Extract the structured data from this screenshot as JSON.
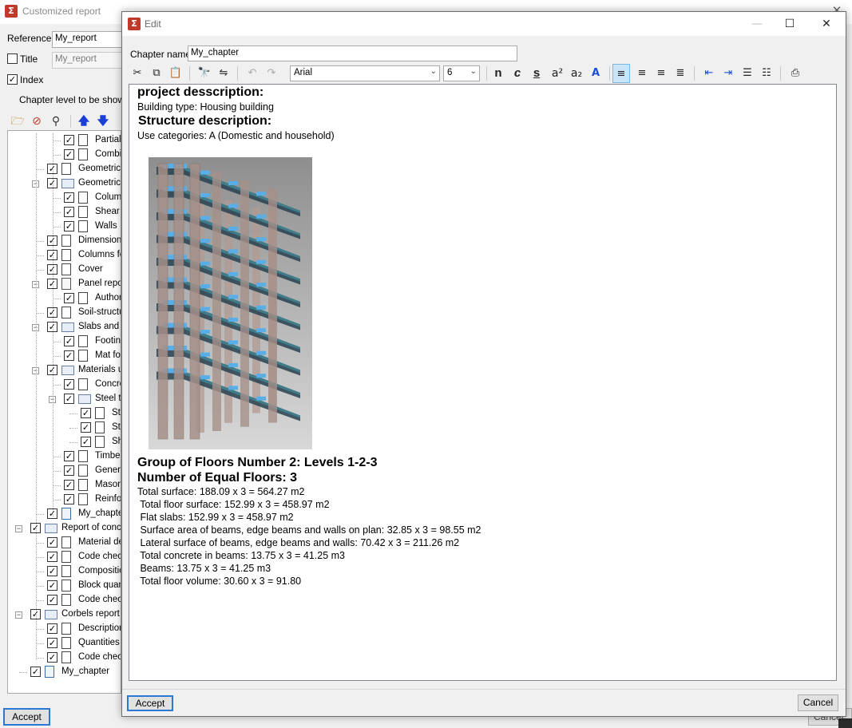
{
  "bg": {
    "title": "Customized report",
    "reference_label": "Reference",
    "reference_value": "My_report",
    "title_label": "Title",
    "title_value": "My_report",
    "index_label": "Index",
    "chapter_level_label": "Chapter level to be shown i",
    "accept_label": "Accept",
    "cancel_peek": "Cancel"
  },
  "tree": [
    {
      "label": "Partial s",
      "level": 3,
      "checked": true,
      "icon": "doc"
    },
    {
      "label": "Combin",
      "level": 3,
      "checked": true,
      "icon": "doc"
    },
    {
      "label": "Geometrical",
      "level": 2,
      "checked": true,
      "icon": "doc"
    },
    {
      "label": "Geometrical",
      "level": 2,
      "checked": true,
      "icon": "folder",
      "expander": "−"
    },
    {
      "label": "Columns",
      "level": 3,
      "checked": true,
      "icon": "doc"
    },
    {
      "label": "Shear w",
      "level": 3,
      "checked": true,
      "icon": "doc"
    },
    {
      "label": "Walls",
      "level": 3,
      "checked": true,
      "icon": "doc"
    },
    {
      "label": "Dimensions,",
      "level": 2,
      "checked": true,
      "icon": "doc"
    },
    {
      "label": "Columns for",
      "level": 2,
      "checked": true,
      "icon": "doc"
    },
    {
      "label": "Cover",
      "level": 2,
      "checked": true,
      "icon": "doc"
    },
    {
      "label": "Panel report",
      "level": 2,
      "checked": true,
      "icon": "lock",
      "expander": "−"
    },
    {
      "label": "Authoriz",
      "level": 3,
      "checked": true,
      "icon": "doc"
    },
    {
      "label": "Soil-structure",
      "level": 2,
      "checked": true,
      "icon": "doc"
    },
    {
      "label": "Slabs and fo",
      "level": 2,
      "checked": true,
      "icon": "folder",
      "expander": "−"
    },
    {
      "label": "Footing",
      "level": 3,
      "checked": true,
      "icon": "doc"
    },
    {
      "label": "Mat fou",
      "level": 3,
      "checked": true,
      "icon": "doc"
    },
    {
      "label": "Materials us",
      "level": 2,
      "checked": true,
      "icon": "folder",
      "expander": "−"
    },
    {
      "label": "Concret",
      "level": 3,
      "checked": true,
      "icon": "doc"
    },
    {
      "label": "Steel typ",
      "level": 3,
      "checked": true,
      "icon": "folder",
      "expander": "−"
    },
    {
      "label": "Ste",
      "level": 4,
      "checked": true,
      "icon": "doc"
    },
    {
      "label": "Ste",
      "level": 4,
      "checked": true,
      "icon": "doc"
    },
    {
      "label": "She",
      "level": 4,
      "checked": true,
      "icon": "doc"
    },
    {
      "label": "Timber",
      "level": 3,
      "checked": true,
      "icon": "doc"
    },
    {
      "label": "Generic",
      "level": 3,
      "checked": true,
      "icon": "doc"
    },
    {
      "label": "Masonry",
      "level": 3,
      "checked": true,
      "icon": "doc"
    },
    {
      "label": "Reinforc",
      "level": 3,
      "checked": true,
      "icon": "doc"
    },
    {
      "label": "My_chapter",
      "level": 2,
      "checked": true,
      "icon": "edit"
    },
    {
      "label": "Report of concre",
      "level": 1,
      "checked": true,
      "icon": "folder",
      "expander": "−"
    },
    {
      "label": "Material des",
      "level": 2,
      "checked": true,
      "icon": "doc"
    },
    {
      "label": "Code check",
      "level": 2,
      "checked": true,
      "icon": "doc"
    },
    {
      "label": "Composition",
      "level": 2,
      "checked": true,
      "icon": "doc"
    },
    {
      "label": "Block quant",
      "level": 2,
      "checked": true,
      "icon": "doc"
    },
    {
      "label": "Code check",
      "level": 2,
      "checked": true,
      "icon": "doc"
    },
    {
      "label": "Corbels report",
      "level": 1,
      "checked": true,
      "icon": "folder",
      "expander": "−"
    },
    {
      "label": "Description",
      "level": 2,
      "checked": true,
      "icon": "doc"
    },
    {
      "label": "Quantities",
      "level": 2,
      "checked": true,
      "icon": "doc"
    },
    {
      "label": "Code check",
      "level": 2,
      "checked": true,
      "icon": "doc"
    },
    {
      "label": "My_chapter",
      "level": 1,
      "checked": true,
      "icon": "edit"
    }
  ],
  "edit": {
    "title": "Edit",
    "chapter_name_label": "Chapter name",
    "chapter_name_value": "My_chapter",
    "font_name": "Arial",
    "font_size": "6",
    "accept_label": "Accept",
    "cancel_label": "Cancel"
  },
  "content": {
    "h1": "project desscription:",
    "p1": "Building type: Housing building",
    "h2": "Structure description:",
    "p2": "Use categories: A (Domestic and household)",
    "h3": "Group of Floors Number 2: Levels 1-2-3",
    "h4": "Number of Equal Floors: 3",
    "lines": [
      "Total surface: 188.09 x 3 = 564.27 m2",
      " Total floor surface: 152.99 x 3 = 458.97 m2",
      " Flat slabs: 152.99 x 3 = 458.97 m2",
      " Surface area of beams, edge beams and walls on plan: 32.85 x 3 = 98.55 m2",
      " Lateral surface of beams, edge beams and walls: 70.42 x 3 = 211.26 m2",
      " Total concrete in beams: 13.75 x 3 = 41.25 m3",
      " Beams: 13.75 x 3 = 41.25 m3",
      " Total floor volume: 30.60 x 3 = 91.80"
    ]
  },
  "colors": {
    "accent": "#2a78d4",
    "slab_top": "#5aaee8",
    "column": "#a6908a"
  }
}
